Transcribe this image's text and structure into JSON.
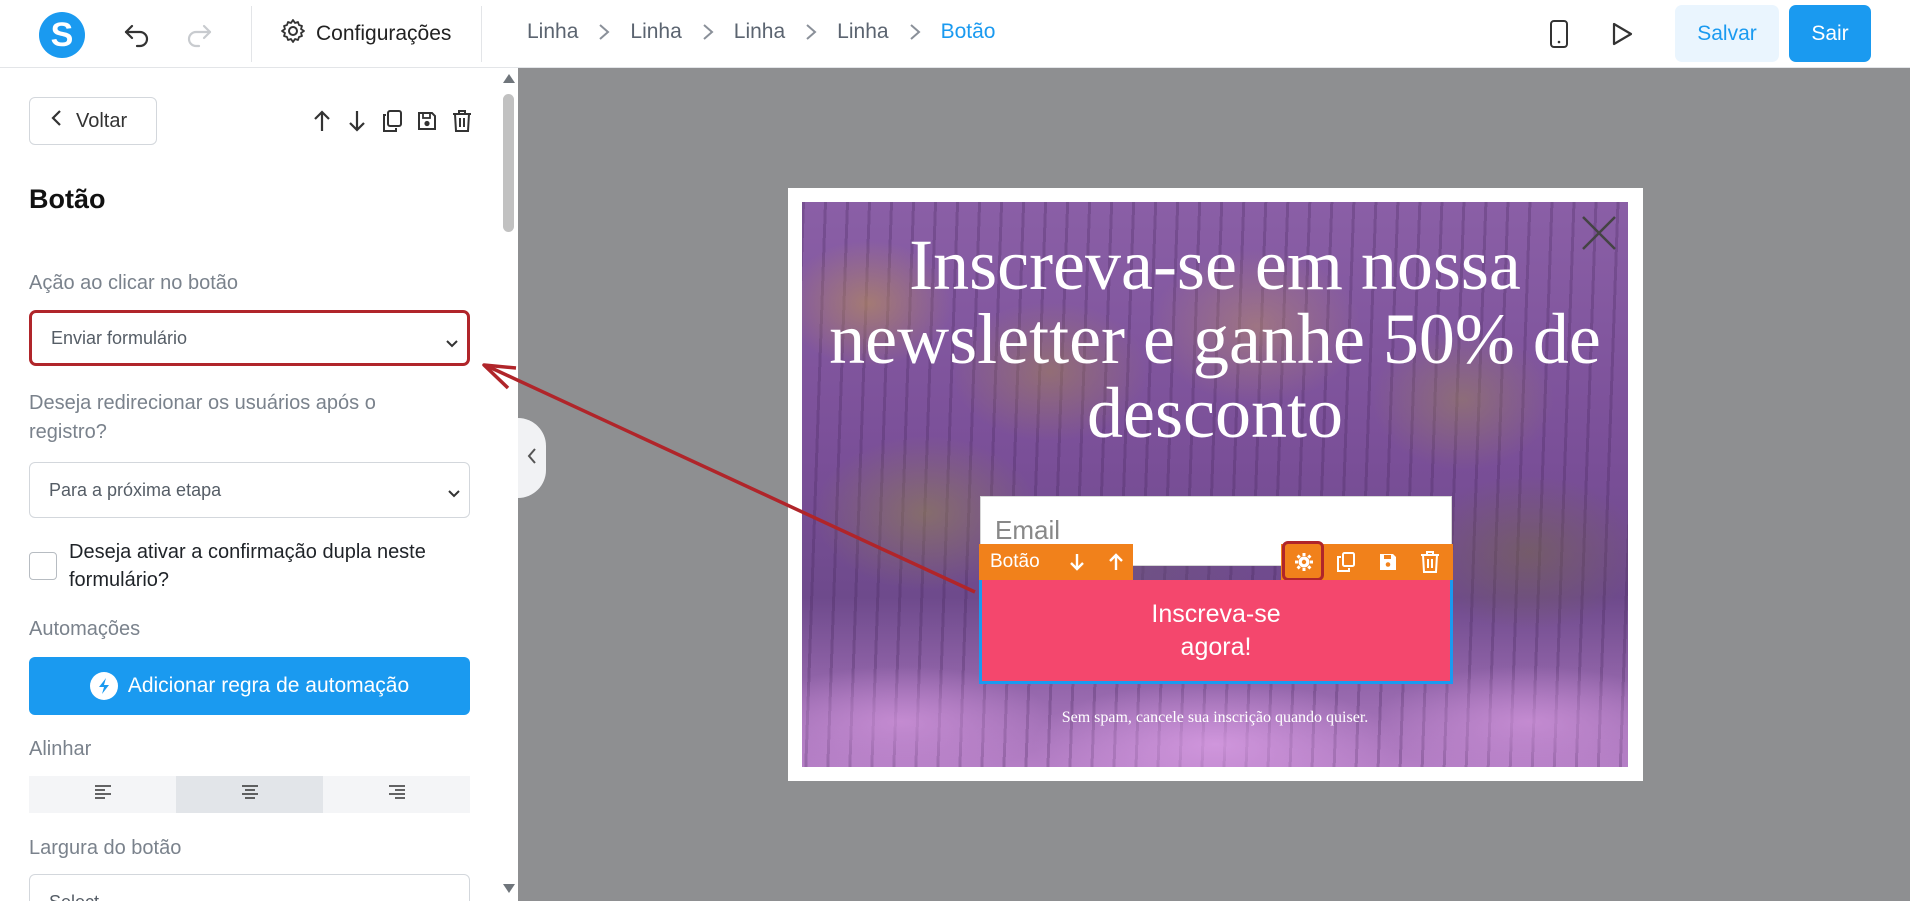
{
  "app": {
    "logo_letter": "S",
    "settings_label": "Configurações",
    "breadcrumb": [
      "Linha",
      "Linha",
      "Linha",
      "Linha",
      "Botão"
    ],
    "save_label": "Salvar",
    "exit_label": "Sair",
    "accent_color": "#1a9af0"
  },
  "panel": {
    "back_label": "Voltar",
    "title": "Botão",
    "action_label": "Ação ao clicar no botão",
    "action_value": "Enviar formulário",
    "redirect_label": "Deseja redirecionar os usuários após o registro?",
    "redirect_value": "Para a próxima etapa",
    "double_optin_label": "Deseja ativar a confirmação dupla neste formulário?",
    "double_optin_checked": false,
    "automations_label": "Automações",
    "automation_button": "Adicionar regra de automação",
    "align_label": "Alinhar",
    "align_selected": "center",
    "width_label": "Largura do botão",
    "width_value": "Select"
  },
  "popup": {
    "heading": "Inscreva-se em nossa newsletter e ganhe 50% de desconto",
    "email_placeholder": "Email",
    "toolbar_label": "Botão",
    "cta_label": "Inscreva-se agora!",
    "footnote": "Sem spam, cancele sua inscrição quando quiser.",
    "cta_color": "#f4476d",
    "toolbar_color": "#f1811b",
    "annotation_color": "#b0252a"
  }
}
